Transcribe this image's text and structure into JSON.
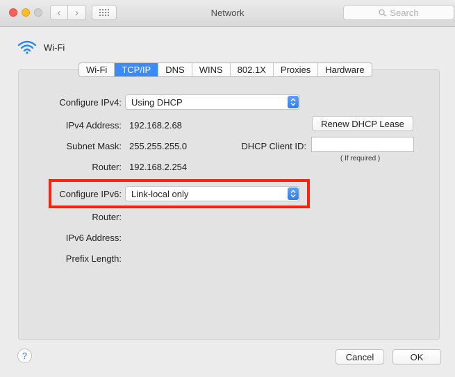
{
  "window": {
    "title": "Network"
  },
  "toolbar": {
    "search_placeholder": "Search"
  },
  "service": {
    "name": "Wi-Fi"
  },
  "tabs": [
    {
      "label": "Wi-Fi",
      "active": false
    },
    {
      "label": "TCP/IP",
      "active": true
    },
    {
      "label": "DNS",
      "active": false
    },
    {
      "label": "WINS",
      "active": false
    },
    {
      "label": "802.1X",
      "active": false
    },
    {
      "label": "Proxies",
      "active": false
    },
    {
      "label": "Hardware",
      "active": false
    }
  ],
  "ipv4": {
    "configure_label": "Configure IPv4:",
    "configure_value": "Using DHCP",
    "address_label": "IPv4 Address:",
    "address_value": "192.168.2.68",
    "subnet_label": "Subnet Mask:",
    "subnet_value": "255.255.255.0",
    "router_label": "Router:",
    "router_value": "192.168.2.254"
  },
  "dhcp": {
    "renew_label": "Renew DHCP Lease",
    "client_id_label": "DHCP Client ID:",
    "client_id_value": "",
    "client_id_hint": "( If required )"
  },
  "ipv6": {
    "configure_label": "Configure IPv6:",
    "configure_value": "Link-local only",
    "router_label": "Router:",
    "address_label": "IPv6 Address:",
    "prefix_label": "Prefix Length:"
  },
  "footer": {
    "help_label": "?",
    "cancel_label": "Cancel",
    "ok_label": "OK"
  },
  "colors": {
    "highlight_box": "#ff2010",
    "accent": "#3b8af7"
  }
}
